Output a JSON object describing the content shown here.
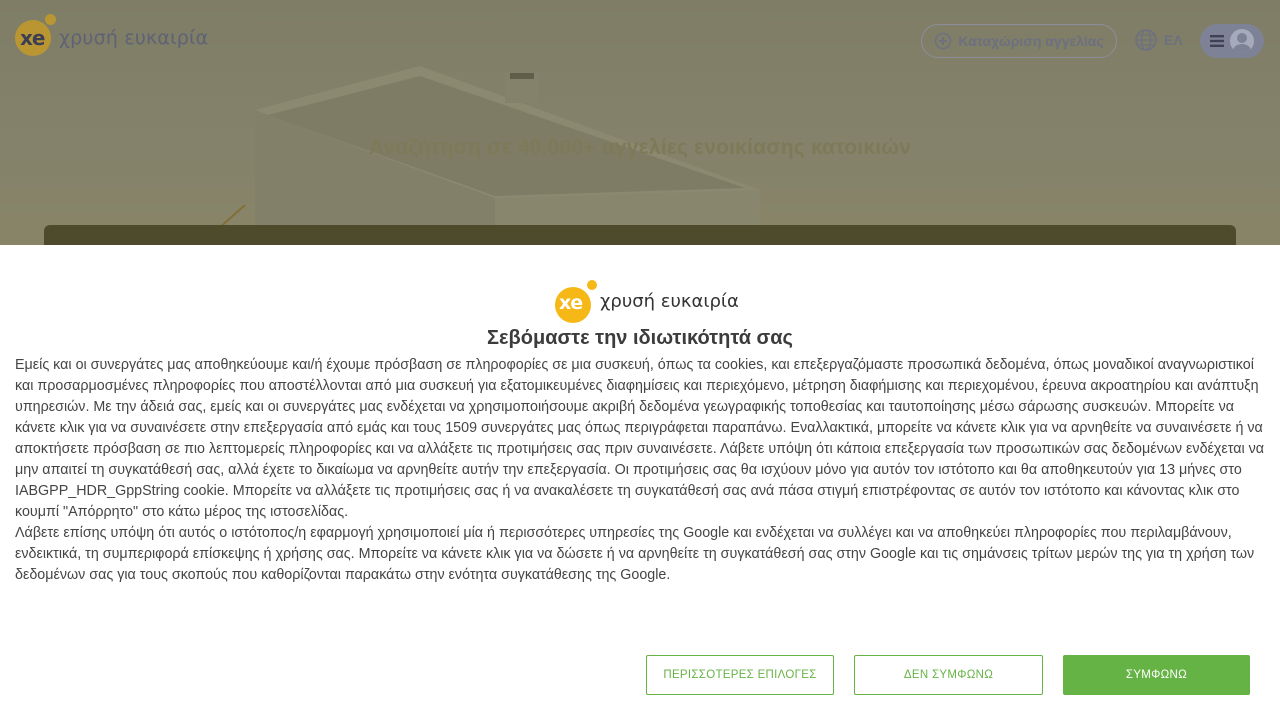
{
  "header": {
    "logo_text": "χρυσή ευκαιρία",
    "logo_mark": "xe",
    "post_ad_label": "Καταχώριση αγγελίας",
    "language_label": "ΕΛ"
  },
  "hero": {
    "title": "Αναζήτηση σε 40.000+ αγγελίες ενοικίασης κατοικιών"
  },
  "consent": {
    "logo_text": "χρυσή ευκαιρία",
    "logo_mark": "xe",
    "title": "Σεβόμαστε την ιδιωτικότητά σας",
    "paragraph1": "Εμείς και οι συνεργάτες μας αποθηκεύουμε και/ή έχουμε πρόσβαση σε πληροφορίες σε μια συσκευή, όπως τα cookies, και επεξεργαζόμαστε προσωπικά δεδομένα, όπως μοναδικοί αναγνωριστικοί και προσαρμοσμένες πληροφορίες που αποστέλλονται από μια συσκευή για εξατομικευμένες διαφημίσεις και περιεχόμενο, μέτρηση διαφήμισης και περιεχομένου, έρευνα ακροατηρίου και ανάπτυξη υπηρεσιών. Με την άδειά σας, εμείς και οι συνεργάτες μας ενδέχεται να χρησιμοποιήσουμε ακριβή δεδομένα γεωγραφικής τοποθεσίας και ταυτοποίησης μέσω σάρωσης συσκευών. Μπορείτε να κάνετε κλικ για να συναινέσετε στην επεξεργασία από εμάς και τους 1509 συνεργάτες μας όπως περιγράφεται παραπάνω. Εναλλακτικά, μπορείτε να κάνετε κλικ για να αρνηθείτε να συναινέσετε ή να αποκτήσετε πρόσβαση σε πιο λεπτομερείς πληροφορίες και να αλλάξετε τις προτιμήσεις σας πριν συναινέσετε. Λάβετε υπόψη ότι κάποια επεξεργασία των προσωπικών σας δεδομένων ενδέχεται να μην απαιτεί τη συγκατάθεσή σας, αλλά έχετε το δικαίωμα να αρνηθείτε αυτήν την επεξεργασία. Οι προτιμήσεις σας θα ισχύουν μόνο για αυτόν τον ιστότοπο και θα αποθηκευτούν για 13 μήνες στο IABGPP_HDR_GppString cookie. Μπορείτε να αλλάξετε τις προτιμήσεις σας ή να ανακαλέσετε τη συγκατάθεσή σας ανά πάσα στιγμή επιστρέφοντας σε αυτόν τον ιστότοπο και κάνοντας κλικ στο κουμπί \"Απόρρητο\" στο κάτω μέρος της ιστοσελίδας.",
    "paragraph2": "Λάβετε επίσης υπόψη ότι αυτός ο ιστότοπος/η εφαρμογή χρησιμοποιεί μία ή περισσότερες υπηρεσίες της Google και ενδέχεται να συλλέγει και να αποθηκεύει πληροφορίες που περιλαμβάνουν, ενδεικτικά, τη συμπεριφορά επίσκεψης ή χρήσης σας. Μπορείτε να κάνετε κλικ για να δώσετε ή να αρνηθείτε τη συγκατάθεσή σας στην Google και τις σημάνσεις τρίτων μερών της για τη χρήση των δεδομένων σας για τους σκοπούς που καθορίζονται παρακάτω στην ενότητα συγκατάθεσης της Google.",
    "buttons": {
      "more_options": "ΠΕΡΙΣΣΟΤΕΡΕΣ ΕΠΙΛΟΓΕΣ",
      "disagree": "ΔΕΝ ΣΥΜΦΩΝΩ",
      "agree": "ΣΥΜΦΩΝΩ"
    }
  },
  "colors": {
    "brand_yellow": "#f6b817",
    "accent_green": "#66b345",
    "text_dark": "#3c3c3c"
  },
  "icons": [
    "plus-circle-icon",
    "globe-icon",
    "hamburger-icon",
    "user-avatar-icon"
  ]
}
